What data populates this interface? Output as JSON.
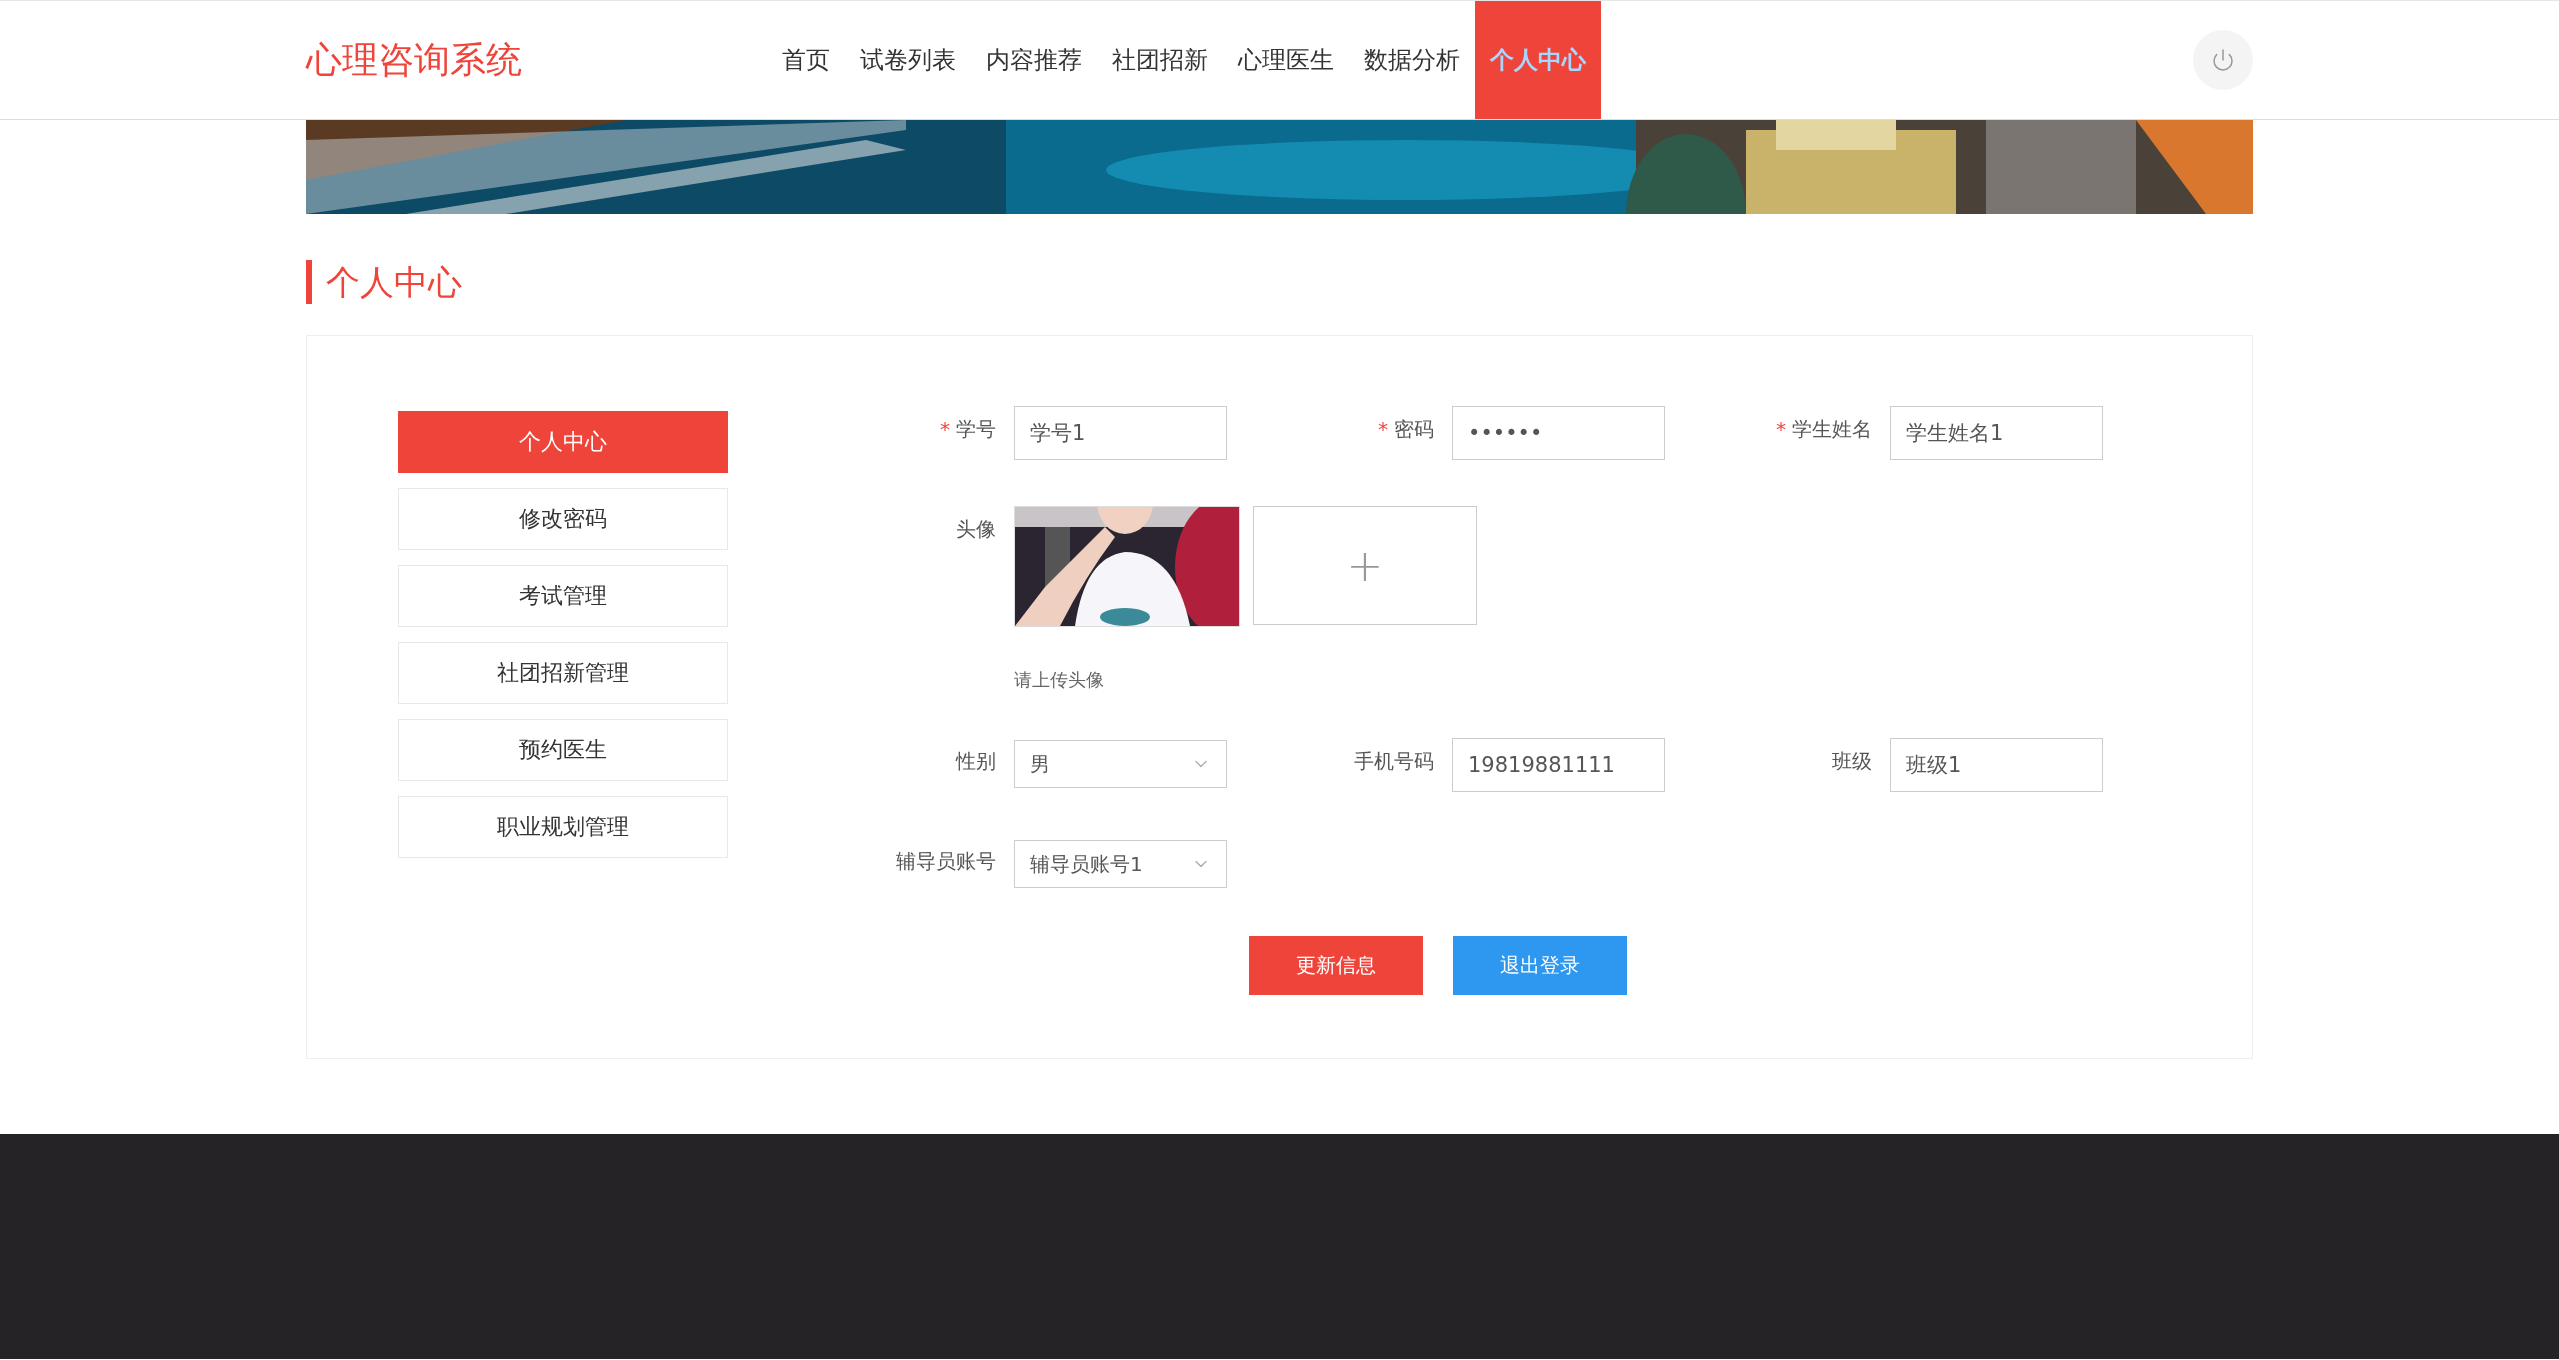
{
  "header": {
    "logo": "心理咨询系统",
    "nav": [
      {
        "label": "首页",
        "selected": false
      },
      {
        "label": "试卷列表",
        "selected": false
      },
      {
        "label": "内容推荐",
        "selected": false
      },
      {
        "label": "社团招新",
        "selected": false
      },
      {
        "label": "心理医生",
        "selected": false
      },
      {
        "label": "数据分析",
        "selected": false
      },
      {
        "label": "个人中心",
        "selected": true
      }
    ]
  },
  "section_title": "个人中心",
  "sidebar": {
    "items": [
      {
        "label": "个人中心",
        "selected": true
      },
      {
        "label": "修改密码",
        "selected": false
      },
      {
        "label": "考试管理",
        "selected": false
      },
      {
        "label": "社团招新管理",
        "selected": false
      },
      {
        "label": "预约医生",
        "selected": false
      },
      {
        "label": "职业规划管理",
        "selected": false
      }
    ]
  },
  "form": {
    "fields": [
      {
        "kind": "text",
        "label": "学号",
        "required_mark": "*",
        "value": "学号1"
      },
      {
        "kind": "text",
        "label": "密码",
        "required_mark": "*",
        "value": "••••••"
      },
      {
        "kind": "text",
        "label": "学生姓名",
        "required_mark": "*",
        "value": "学生姓名1"
      },
      {
        "kind": "avatar",
        "label": "头像",
        "hint": "请上传头像",
        "upload": "+"
      },
      {
        "kind": "select",
        "label": "性别",
        "value": "男"
      },
      {
        "kind": "text",
        "label": "手机号码",
        "value": "19819881111"
      },
      {
        "kind": "text",
        "label": "班级",
        "value": "班级1"
      },
      {
        "kind": "select",
        "label": "辅导员账号",
        "value": "辅导员账号1"
      }
    ],
    "buttons": [
      {
        "label": "更新信息",
        "kind": "primary"
      },
      {
        "label": "退出登录",
        "kind": "secondary"
      }
    ]
  }
}
